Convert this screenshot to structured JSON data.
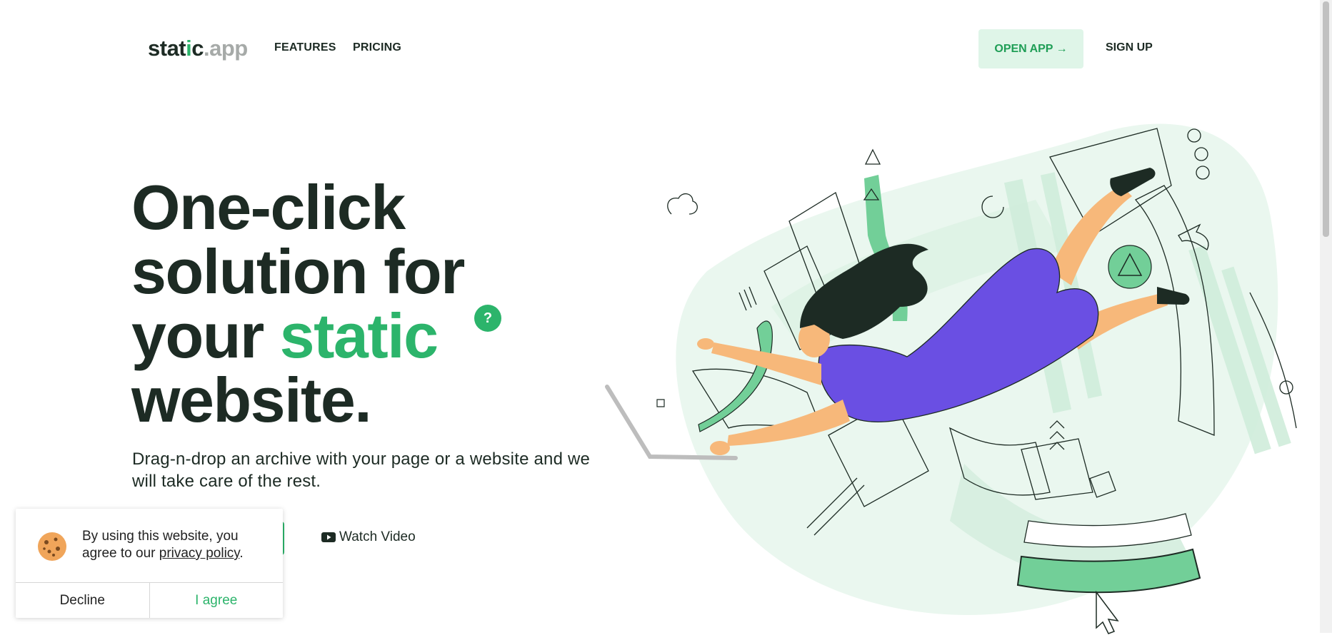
{
  "header": {
    "logo": {
      "part1": "stat",
      "part2": "i",
      "part3": "c",
      "part4": ".app"
    },
    "nav": {
      "features": "FEATURES",
      "pricing": "PRICING"
    },
    "open_app": "OPEN APP →",
    "sign_up": "SIGN UP"
  },
  "hero": {
    "title_line1": "One-click",
    "title_line2": "solution for",
    "title_line3_a": "your ",
    "title_line3_b": "static",
    "title_line4": "website.",
    "badge": "?",
    "subtitle": "Drag-n-drop an archive with your page or a website and we will take care of the rest.",
    "watch_video": "Watch Video"
  },
  "cookie": {
    "text_before": "By using this website, you agree to our ",
    "link": "privacy policy",
    "text_after": ".",
    "decline": "Decline",
    "agree": "I agree"
  },
  "colors": {
    "brand_green": "#2cb46b",
    "light_green": "#dff5e8",
    "dark_text": "#1d2b24",
    "purple": "#6a4fe3",
    "skin": "#f7b87a"
  }
}
